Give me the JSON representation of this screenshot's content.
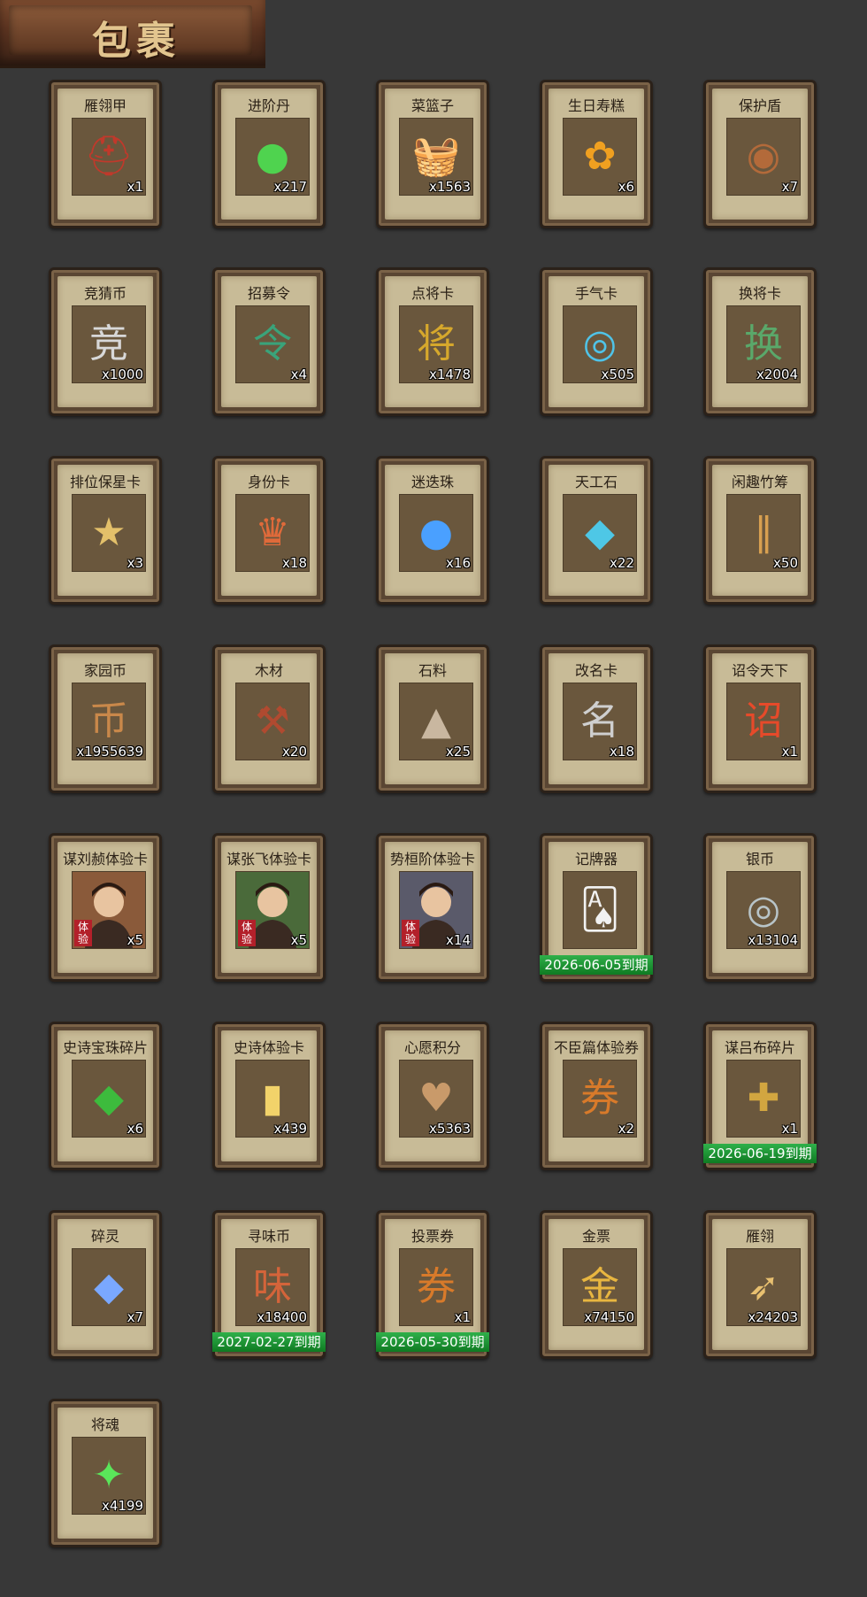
{
  "header": {
    "title": "包裹"
  },
  "items": [
    {
      "name": "雁翎甲",
      "qty": "x1",
      "icon": "helmet-armor-icon",
      "glyph": "⛑",
      "color": "#c0392b"
    },
    {
      "name": "进阶丹",
      "qty": "x217",
      "icon": "green-pill-icon",
      "glyph": "●",
      "color": "#4fd34f"
    },
    {
      "name": "菜篮子",
      "qty": "x1563",
      "icon": "basket-icon",
      "glyph": "🧺",
      "color": "#c98a2c"
    },
    {
      "name": "生日寿糕",
      "qty": "x6",
      "icon": "cake-icon",
      "glyph": "✿",
      "color": "#f0a020"
    },
    {
      "name": "保护盾",
      "qty": "x7",
      "icon": "shield-icon",
      "glyph": "◉",
      "color": "#b36a3a"
    },
    {
      "name": "竞猜币",
      "qty": "x1000",
      "icon": "silver-coin-icon",
      "glyph": "竞",
      "color": "#d8d8d8"
    },
    {
      "name": "招募令",
      "qty": "x4",
      "icon": "recruit-token-icon",
      "glyph": "令",
      "color": "#3aa37a"
    },
    {
      "name": "点将卡",
      "qty": "x1478",
      "icon": "general-card-icon",
      "glyph": "将",
      "color": "#d6a82c"
    },
    {
      "name": "手气卡",
      "qty": "x505",
      "icon": "luck-card-icon",
      "glyph": "◎",
      "color": "#4fc3e8"
    },
    {
      "name": "换将卡",
      "qty": "x2004",
      "icon": "swap-card-icon",
      "glyph": "换",
      "color": "#5aa86a"
    },
    {
      "name": "排位保星卡",
      "qty": "x3",
      "icon": "rank-card-icon",
      "glyph": "★",
      "color": "#e3c06a"
    },
    {
      "name": "身份卡",
      "qty": "x18",
      "icon": "identity-card-icon",
      "glyph": "♛",
      "color": "#e06a3a"
    },
    {
      "name": "迷迭珠",
      "qty": "x16",
      "icon": "blue-orb-icon",
      "glyph": "●",
      "color": "#4aa0ff"
    },
    {
      "name": "天工石",
      "qty": "x22",
      "icon": "crystal-icon",
      "glyph": "◆",
      "color": "#4ec7e6"
    },
    {
      "name": "闲趣竹筹",
      "qty": "x50",
      "icon": "bamboo-tally-icon",
      "glyph": "∥",
      "color": "#d8a050"
    },
    {
      "name": "家园币",
      "qty": "x1955639",
      "icon": "home-coin-icon",
      "glyph": "币",
      "color": "#c9884a"
    },
    {
      "name": "木材",
      "qty": "x20",
      "icon": "wood-icon",
      "glyph": "⚒",
      "color": "#b04a30"
    },
    {
      "name": "石料",
      "qty": "x25",
      "icon": "stone-icon",
      "glyph": "▲",
      "color": "#c9b7a0"
    },
    {
      "name": "改名卡",
      "qty": "x18",
      "icon": "rename-card-icon",
      "glyph": "名",
      "color": "#cfcfcf"
    },
    {
      "name": "诏令天下",
      "qty": "x1",
      "icon": "scroll-icon",
      "glyph": "诏",
      "color": "#e64a2a"
    },
    {
      "name": "谋刘赪体验卡",
      "qty": "x5",
      "icon": "hero-portrait-icon",
      "portrait": true,
      "color": "#8a5a3a",
      "badge": "体验"
    },
    {
      "name": "谋张飞体验卡",
      "qty": "x5",
      "icon": "hero-portrait-icon",
      "portrait": true,
      "color": "#4a6a3a",
      "badge": "体验"
    },
    {
      "name": "势桓阶体验卡",
      "qty": "x14",
      "icon": "hero-portrait-icon",
      "portrait": true,
      "color": "#5a5a6a",
      "badge": "体验"
    },
    {
      "name": "记牌器",
      "qty": "",
      "icon": "playing-cards-icon",
      "glyph": "🂡",
      "color": "#f2f2f2",
      "expiry": "2026-06-05到期"
    },
    {
      "name": "银币",
      "qty": "x13104",
      "icon": "silver-coins-icon",
      "glyph": "◎",
      "color": "#b8c4c8"
    },
    {
      "name": "史诗宝珠碎片",
      "qty": "x6",
      "icon": "green-shard-icon",
      "glyph": "◆",
      "color": "#3dbb3d"
    },
    {
      "name": "史诗体验卡",
      "qty": "x439",
      "icon": "gold-card-icon",
      "glyph": "▮",
      "color": "#f2d36a"
    },
    {
      "name": "心愿积分",
      "qty": "x5363",
      "icon": "heart-coin-icon",
      "glyph": "♥",
      "color": "#c99a6a"
    },
    {
      "name": "不臣篇体验券",
      "qty": "x2",
      "icon": "ticket-icon",
      "glyph": "券",
      "color": "#d87a2a"
    },
    {
      "name": "谋吕布碎片",
      "qty": "x1",
      "icon": "puzzle-piece-icon",
      "glyph": "✚",
      "color": "#d2a640",
      "expiry": "2026-06-19到期"
    },
    {
      "name": "碎灵",
      "qty": "x7",
      "icon": "spirit-shard-icon",
      "glyph": "◆",
      "color": "#7aa8ff"
    },
    {
      "name": "寻味币",
      "qty": "x18400",
      "icon": "flavor-coin-icon",
      "glyph": "味",
      "color": "#d4643a",
      "expiry": "2027-02-27到期"
    },
    {
      "name": "投票券",
      "qty": "x1",
      "icon": "vote-ticket-icon",
      "glyph": "券",
      "color": "#d87a2a",
      "expiry": "2026-05-30到期"
    },
    {
      "name": "金票",
      "qty": "x74150",
      "icon": "gold-ticket-icon",
      "glyph": "金",
      "color": "#e8b640"
    },
    {
      "name": "雁翎",
      "qty": "x24203",
      "icon": "feather-icon",
      "glyph": "➶",
      "color": "#e8c070"
    },
    {
      "name": "将魂",
      "qty": "x4199",
      "icon": "soul-icon",
      "glyph": "✦",
      "color": "#5ae65a"
    }
  ]
}
